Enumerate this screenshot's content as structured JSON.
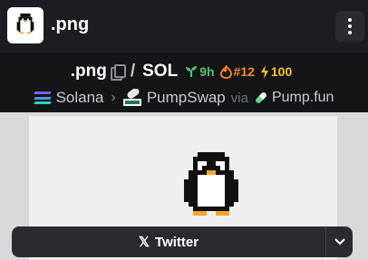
{
  "header": {
    "title": ".png",
    "menu_icon": "kebab-menu-icon"
  },
  "pair": {
    "base": ".png",
    "separator": "/",
    "quote": "SOL",
    "age": "9h",
    "rank": "#12",
    "boosts": "100"
  },
  "chain": {
    "name": "Solana",
    "dex": "PumpSwap",
    "via_label": "via",
    "launchpad": "Pump.fun"
  },
  "links": {
    "twitter_label": "Twitter"
  },
  "colors": {
    "age": "#53c26b",
    "rank": "#ff8a1f",
    "boost": "#f5c518",
    "background": "#141517"
  }
}
